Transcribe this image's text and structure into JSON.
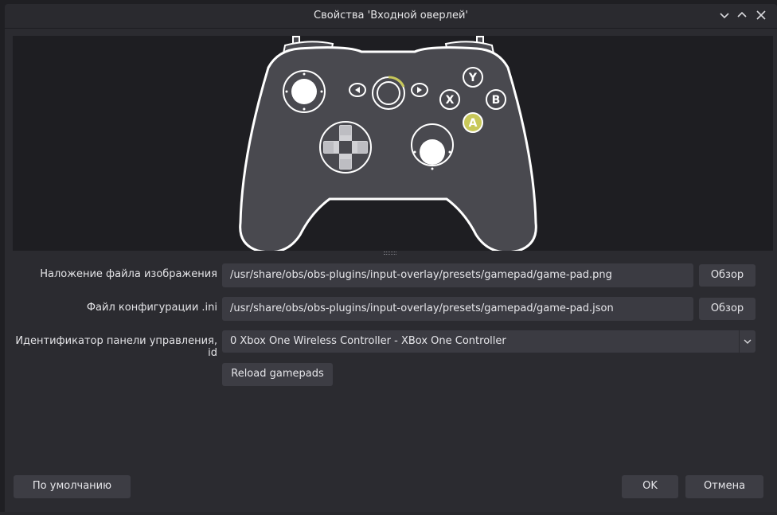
{
  "window": {
    "title": "Свойства 'Входной оверлей'"
  },
  "form": {
    "image_label": "Наложение файла изображения",
    "image_path": "/usr/share/obs/obs-plugins/input-overlay/presets/gamepad/game-pad.png",
    "image_browse": "Обзор",
    "config_label": "Файл конфигурации .ini",
    "config_path": "/usr/share/obs/obs-plugins/input-overlay/presets/gamepad/game-pad.json",
    "config_browse": "Обзор",
    "gamepad_label": "Идентификатор панели управления, id",
    "gamepad_value": "0 Xbox One Wireless Controller - XBox One Controller",
    "reload_label": "Reload gamepads"
  },
  "footer": {
    "defaults_label": "По умолчанию",
    "ok_label": "OK",
    "cancel_label": "Отмена"
  },
  "gamepad": {
    "face_buttons": [
      "Y",
      "X",
      "B",
      "A"
    ],
    "highlight_color": "#c8c85a",
    "body_color": "#49494f"
  },
  "colors": {
    "dialog_bg": "#2b2b30",
    "field_bg": "#3b3b42",
    "button_bg": "#3d3d44",
    "preview_bg": "#1e1e22"
  }
}
